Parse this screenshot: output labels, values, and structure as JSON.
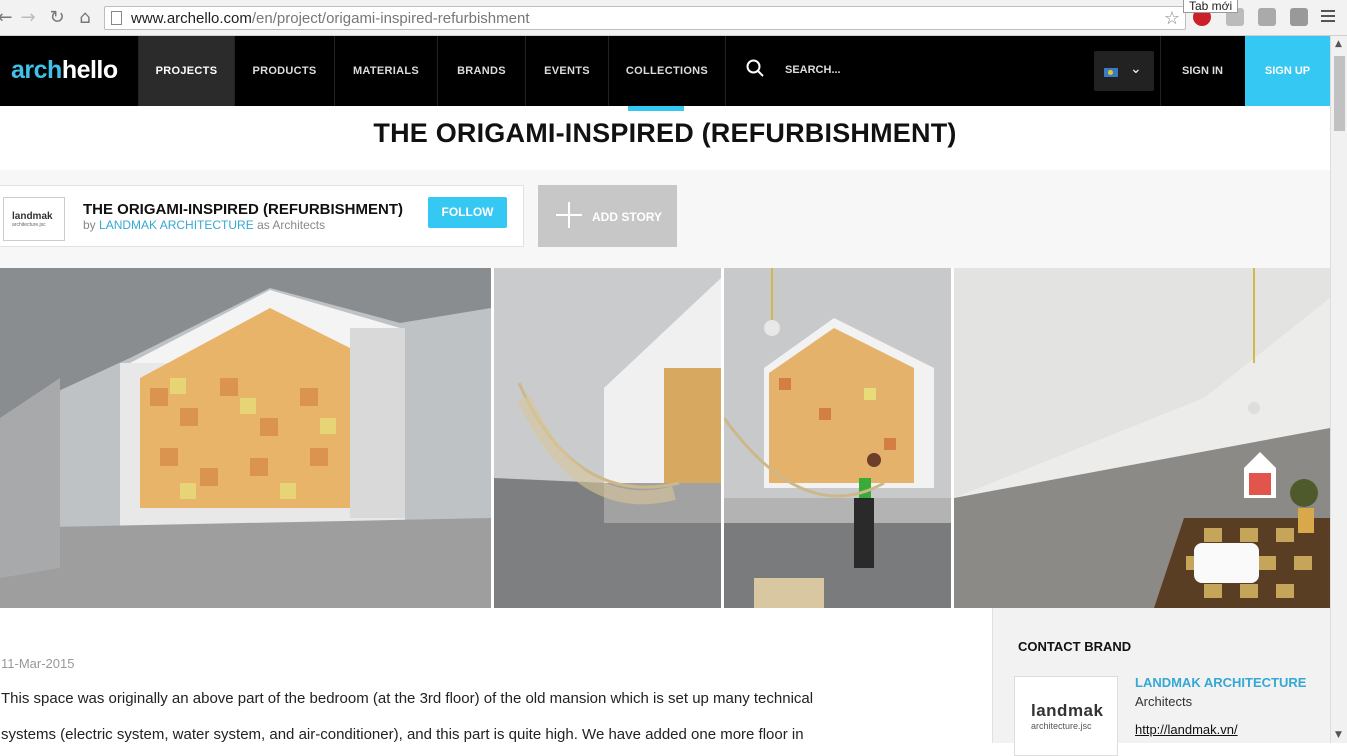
{
  "browser": {
    "url_host": "www.archello.com",
    "url_path": "/en/project/origami-inspired-refurbishment",
    "tooltip": "Tab mới",
    "icons": [
      "back-icon",
      "forward-icon",
      "reload-icon",
      "home-icon",
      "bookmark-star-icon",
      "pinterest-icon",
      "menu-icon"
    ]
  },
  "header": {
    "logo_a": "arch",
    "logo_b": "hello",
    "nav": [
      "PROJECTS",
      "PRODUCTS",
      "MATERIALS",
      "BRANDS",
      "EVENTS",
      "COLLECTIONS"
    ],
    "active_nav": "PROJECTS",
    "search_placeholder": "SEARCH...",
    "sign_in": "SIGN IN",
    "sign_up": "SIGN UP",
    "accent_color": "#35c8f2"
  },
  "page": {
    "title": "THE ORIGAMI-INSPIRED (REFURBISHMENT)"
  },
  "project_card": {
    "logo_text": "landmak",
    "logo_sub": "architecture.jsc",
    "title": "THE ORIGAMI-INSPIRED (REFURBISHMENT)",
    "by": "by",
    "brand": "LANDMAK ARCHITECTURE",
    "role": "as Architects",
    "follow": "FOLLOW",
    "add_story": "ADD STORY"
  },
  "article": {
    "date": "11-Mar-2015",
    "line1": "This space was originally an above part of the bedroom (at the 3rd floor) of the old mansion which is set up many technical",
    "line2": "systems (electric system, water system, and air-conditioner), and this part is quite high. We have added one more floor in"
  },
  "contact": {
    "title": "CONTACT BRAND",
    "logo_text": "landmak",
    "logo_sub": "architecture.jsc",
    "name": "LANDMAK ARCHITECTURE",
    "role": "Architects",
    "url": "http://landmak.vn/"
  }
}
